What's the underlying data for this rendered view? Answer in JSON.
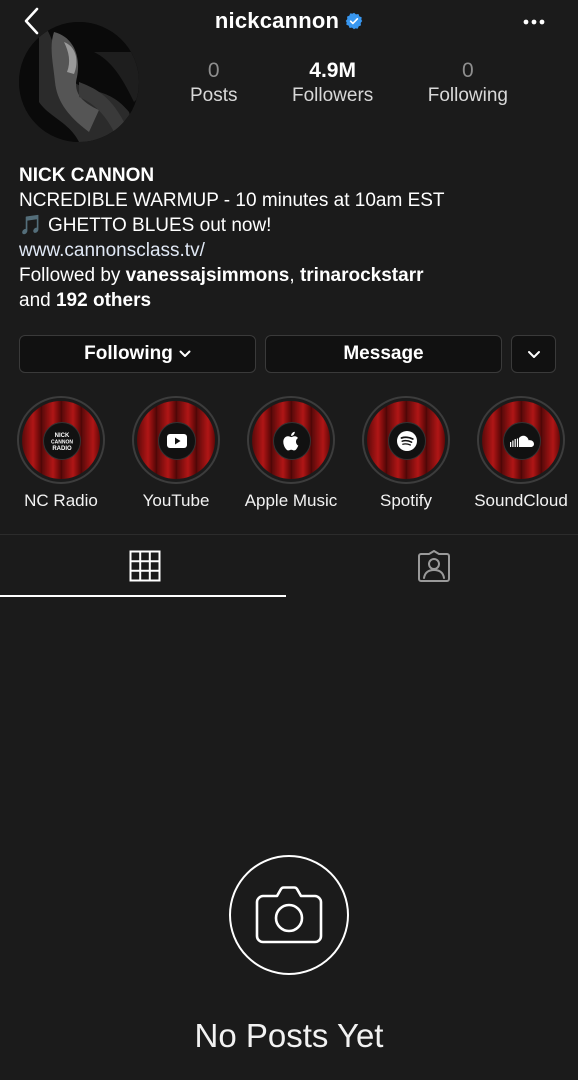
{
  "header": {
    "username": "nickcannon",
    "verified": true
  },
  "profile": {
    "stats": [
      {
        "value": "0",
        "label": "Posts"
      },
      {
        "value": "4.9M",
        "label": "Followers"
      },
      {
        "value": "0",
        "label": "Following"
      }
    ],
    "name": "NICK CANNON",
    "bio_line1": "NCREDIBLE WARMUP - 10 minutes at 10am EST",
    "bio_line2_emoji": "🎵",
    "bio_line2": "GHETTO BLUES out now!",
    "website": "www.cannonsclass.tv/",
    "followed_by_prefix": "Followed by ",
    "followed_by_user1": "vanessajsimmons",
    "followed_by_sep": ", ",
    "followed_by_user2": "trinarockstarr",
    "followed_by_and": "and ",
    "followed_by_others": "192 others"
  },
  "buttons": {
    "following_label": "Following",
    "message_label": "Message"
  },
  "highlights": [
    {
      "label": "NC Radio",
      "icon": "nc-radio-logo-icon",
      "logo_text": [
        "NICK",
        "CANNON",
        "RADIO"
      ]
    },
    {
      "label": "YouTube",
      "icon": "youtube-icon"
    },
    {
      "label": "Apple Music",
      "icon": "apple-icon"
    },
    {
      "label": "Spotify",
      "icon": "spotify-icon"
    },
    {
      "label": "SoundCloud",
      "icon": "soundcloud-icon"
    }
  ],
  "tabs": [
    {
      "name": "grid",
      "icon": "grid-icon",
      "active": true
    },
    {
      "name": "tagged",
      "icon": "tagged-person-icon",
      "active": false
    }
  ],
  "empty_state": {
    "icon": "camera-icon",
    "text": "No Posts Yet"
  },
  "colors": {
    "background": "#1b1b1b",
    "verified_blue": "#3897f0",
    "highlight_red": "#b01616"
  }
}
